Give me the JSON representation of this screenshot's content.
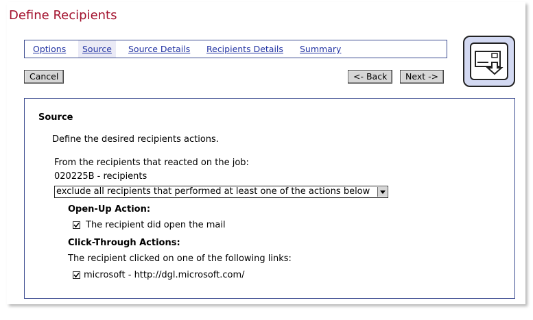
{
  "page": {
    "title": "Define Recipients"
  },
  "nav": {
    "tabs": [
      {
        "label": "Options"
      },
      {
        "label": "Source"
      },
      {
        "label": "Source Details"
      },
      {
        "label": "Recipients Details"
      },
      {
        "label": "Summary"
      }
    ],
    "active_tab": "Source"
  },
  "buttons": {
    "cancel": "Cancel",
    "back": "<- Back",
    "next": "Next ->"
  },
  "wizard_icon": "recipients-wizard-icon",
  "source": {
    "heading": "Source",
    "instructions": "Define the desired recipients actions.",
    "from_label": "From the recipients that reacted on the job:",
    "job_line": "020225B - recipients",
    "filter_select": {
      "selected": "exclude all recipients that performed at least one of the actions below"
    },
    "open_up": {
      "heading": "Open-Up Action:",
      "option": {
        "label": "The recipient did open the mail",
        "checked": true
      }
    },
    "click_through": {
      "heading": "Click-Through Actions:",
      "description": "The recipient clicked on one of the following links:",
      "links": [
        {
          "label": "microsoft - http://dgl.microsoft.com/",
          "checked": true
        }
      ]
    }
  },
  "colors": {
    "title": "#a3122e",
    "link": "#2233a3",
    "border": "#3a4a8f",
    "icon_bg": "#d3d9f2"
  }
}
